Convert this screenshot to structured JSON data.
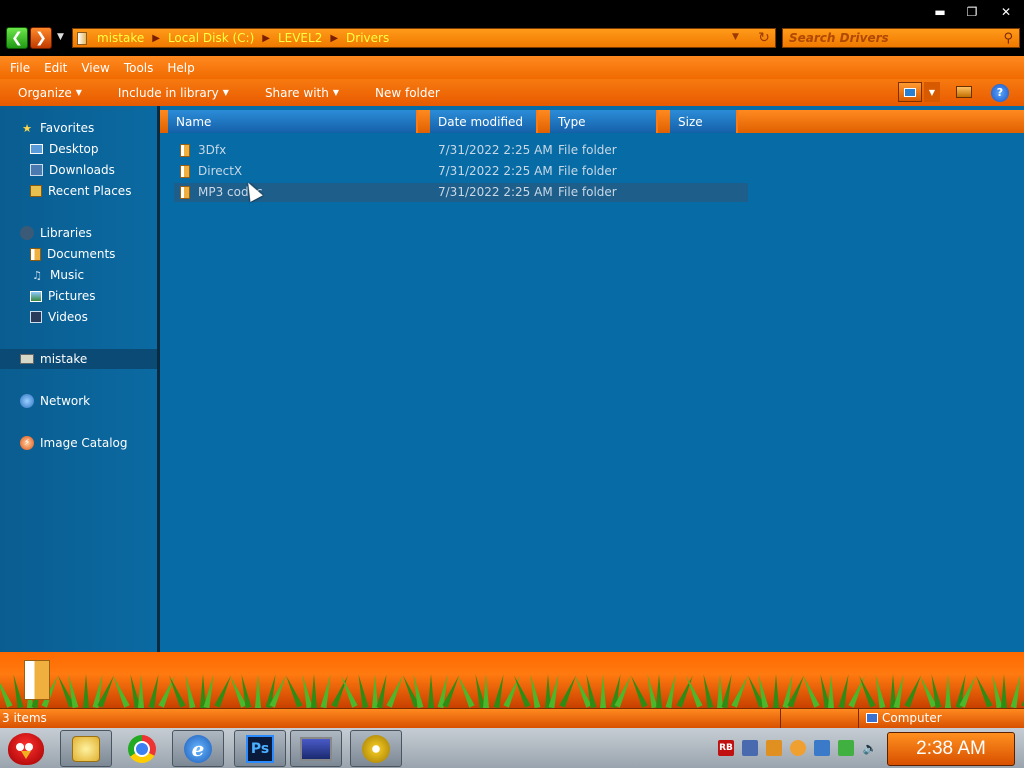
{
  "window": {
    "minimize_label": "▬",
    "maximize_label": "❐",
    "close_label": "✕"
  },
  "address": {
    "crumbs": [
      "mistake",
      "Local Disk (C:)",
      "LEVEL2",
      "Drivers"
    ]
  },
  "search": {
    "placeholder": "Search Drivers"
  },
  "menu": [
    "File",
    "Edit",
    "View",
    "Tools",
    "Help"
  ],
  "toolbar": {
    "organize": "Organize",
    "include_in_library": "Include in library",
    "share_with": "Share with",
    "new_folder": "New folder",
    "help": "?"
  },
  "nav": {
    "favorites": "Favorites",
    "desktop": "Desktop",
    "downloads": "Downloads",
    "recent_places": "Recent Places",
    "libraries": "Libraries",
    "documents": "Documents",
    "music": "Music",
    "pictures": "Pictures",
    "videos": "Videos",
    "computer": "mistake",
    "network": "Network",
    "image_catalog": "Image Catalog"
  },
  "columns": {
    "name": "Name",
    "date": "Date modified",
    "type": "Type",
    "size": "Size"
  },
  "files": [
    {
      "name": "3Dfx",
      "date": "7/31/2022 2:25 AM",
      "type": "File folder"
    },
    {
      "name": "DirectX",
      "date": "7/31/2022 2:25 AM",
      "type": "File folder"
    },
    {
      "name": "MP3 codec",
      "date": "7/31/2022 2:25 AM",
      "type": "File folder"
    }
  ],
  "status": {
    "count": "3 items",
    "zone": "Computer"
  },
  "tray": {
    "rb": "RB"
  },
  "clock": "2:38 AM"
}
